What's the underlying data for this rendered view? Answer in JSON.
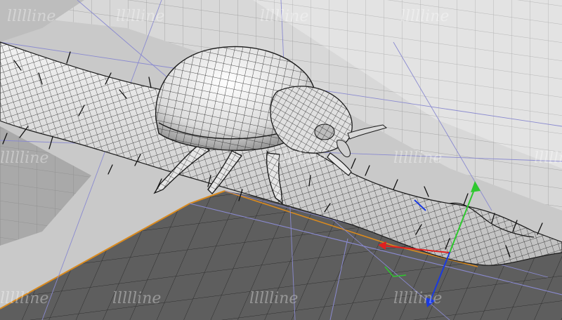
{
  "viewport": {
    "name": "3D Perspective Viewport",
    "background_color": "#c9c9c9",
    "wire_color": "#1a1a1a",
    "grid_color": "#8a8ad0",
    "selection_color": "#d98a1e"
  },
  "watermark": {
    "text": "llllline",
    "repeat": 12
  },
  "scene_objects": [
    {
      "id": "beetle_shell",
      "label": "beetle-shell-mesh"
    },
    {
      "id": "beetle_head",
      "label": "beetle-head-mesh"
    },
    {
      "id": "beetle_legs",
      "label": "beetle-leg-meshes"
    },
    {
      "id": "branch",
      "label": "branch-mesh"
    },
    {
      "id": "hair_strands",
      "label": "hair-strands"
    },
    {
      "id": "ground_plane",
      "label": "ground-plane"
    }
  ],
  "gizmo": {
    "x_axis_color": "#e02020",
    "y_axis_color": "#2ec82e",
    "z_axis_color": "#1a3ae0"
  }
}
